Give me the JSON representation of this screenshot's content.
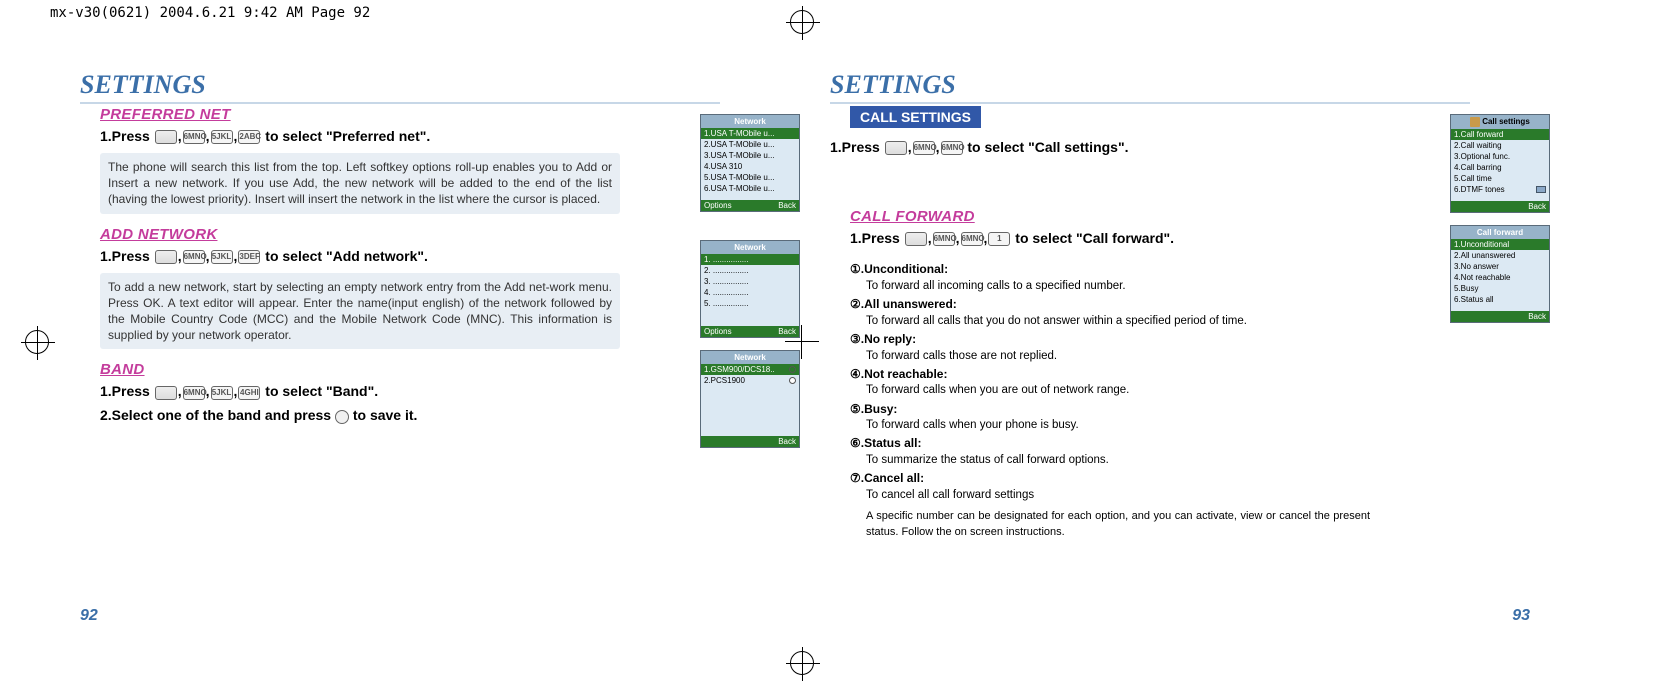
{
  "header_strip": "mx-v30(0621)  2004.6.21  9:42 AM  Page 92",
  "left": {
    "title": "SETTINGS",
    "sections": {
      "preferred": {
        "heading": "PREFERRED NET",
        "step1_prefix": "1.Press",
        "step1_suffix": "to select \"Preferred net\".",
        "keys": [
          "6MNO",
          "5JKL",
          "2ABC"
        ],
        "info": "The phone will search this list from the top. Left softkey options roll-up enables you to Add or Insert a new network. If you use Add, the new network will be added to the end of the list (having the lowest priority). Insert will insert the network in the list where the cursor is placed."
      },
      "add": {
        "heading": "ADD NETWORK",
        "step1_prefix": "1.Press",
        "step1_suffix": "to select \"Add network\".",
        "keys": [
          "6MNO",
          "5JKL",
          "3DEF"
        ],
        "info": "To add a new network, start by selecting an empty network entry from the Add net-work menu. Press OK. A text editor will appear. Enter the name(input english) of the network followed by the Mobile Country Code (MCC) and the Mobile Network Code (MNC). This information is supplied by your network operator."
      },
      "band": {
        "heading": "BAND",
        "step1_prefix": "1.Press",
        "step1_suffix": "to select \"Band\".",
        "keys": [
          "6MNO",
          "5JKL",
          "4GHI"
        ],
        "step2": "2.Select one of the band and press",
        "step2_suffix": "to save it."
      }
    },
    "screens": {
      "preferred": {
        "title": "Network",
        "items": [
          "1.USA T-MObile u...",
          "2.USA T-MObile u...",
          "3.USA T-MObile u...",
          "4.USA 310",
          "5.USA T-MObile u...",
          "6.USA T-MObile u..."
        ],
        "footer_left": "Options",
        "footer_right": "Back"
      },
      "add": {
        "title": "Network",
        "items": [
          "1. ................",
          "2. ................",
          "3. ................",
          "4. ................",
          "5. ................"
        ],
        "footer_left": "Options",
        "footer_right": "Back"
      },
      "band": {
        "title": "Network",
        "items": [
          "1.GSM900/DCS18..",
          "2.PCS1900"
        ],
        "footer_left": "",
        "footer_right": "Back"
      }
    },
    "page_num": "92"
  },
  "right": {
    "title": "SETTINGS",
    "tab": "CALL SETTINGS",
    "step1_prefix": "1.Press",
    "step1_suffix": "to select \"Call settings\".",
    "step1_keys": [
      "6MNO",
      "6MNO"
    ],
    "callforward": {
      "heading": "CALL FORWARD",
      "step1_prefix": "1.Press",
      "step1_suffix": "to select \"Call forward\".",
      "keys": [
        "6MNO",
        "6MNO",
        "1"
      ],
      "items": [
        {
          "num": "①",
          "label": ".Unconditional:",
          "desc": "To forward all incoming calls to a specified number."
        },
        {
          "num": "②",
          "label": ".All unanswered:",
          "desc": "To forward all calls that you do not answer within a specified period of time."
        },
        {
          "num": "③",
          "label": ".No reply:",
          "desc": "To forward calls those are not replied."
        },
        {
          "num": "④",
          "label": ".Not reachable:",
          "desc": "To forward calls when you are out of network range."
        },
        {
          "num": "⑤",
          "label": ".Busy:",
          "desc": "To forward calls when your phone is busy."
        },
        {
          "num": "⑥",
          "label": ".Status all:",
          "desc": "To summarize the status of call forward options."
        },
        {
          "num": "⑦",
          "label": ".Cancel all:",
          "desc": "To cancel all call forward settings"
        }
      ],
      "footnote": "A specific number can be designated for each option, and you can activate, view or cancel the present status. Follow the on screen instructions."
    },
    "screens": {
      "callsettings": {
        "title": "Call settings",
        "items": [
          "1.Call forward",
          "2.Call waiting",
          "3.Optional func.",
          "4.Call barring",
          "5.Call time",
          "6.DTMF tones"
        ],
        "footer_right": "Back"
      },
      "callforward": {
        "title": "Call forward",
        "items": [
          "1.Unconditional",
          "2.All unanswered",
          "3.No answer",
          "4.Not reachable",
          "5.Busy",
          "6.Status all"
        ],
        "footer_right": "Back"
      }
    },
    "page_num": "93"
  }
}
